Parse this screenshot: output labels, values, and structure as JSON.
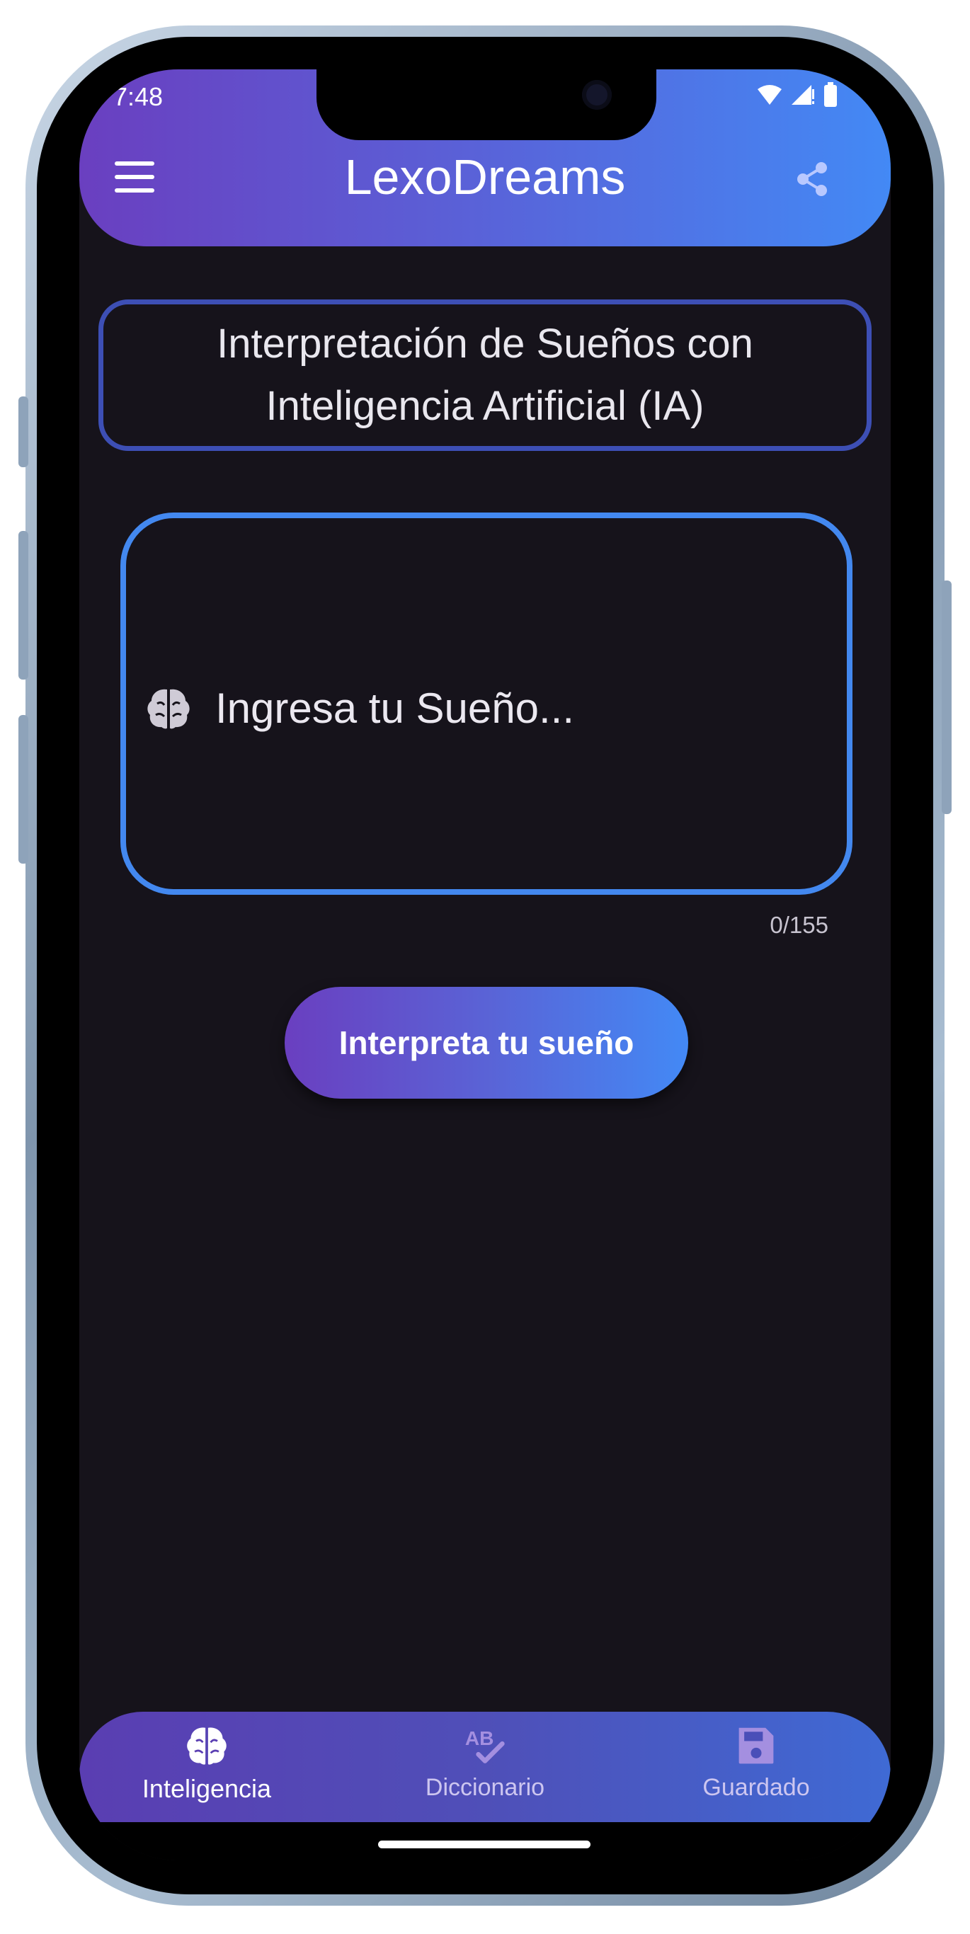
{
  "status_bar": {
    "time": "7:48"
  },
  "header": {
    "title": "LexoDreams",
    "menu_icon": "hamburger-menu-icon",
    "share_icon": "share-icon"
  },
  "title_box": {
    "text": "Interpretación de Sueños con Inteligencia Artificial (IA)"
  },
  "dream_input": {
    "placeholder": "Ingresa tu Sueño...",
    "counter": "0/155",
    "icon": "brain-icon"
  },
  "interpret_button": {
    "label": "Interpreta tu sueño"
  },
  "bottom_nav": {
    "items": [
      {
        "label": "Inteligencia",
        "icon": "brain-icon",
        "active": true
      },
      {
        "label": "Diccionario",
        "icon": "spellcheck-icon",
        "active": false
      },
      {
        "label": "Guardado",
        "icon": "save-icon",
        "active": false
      }
    ]
  },
  "colors": {
    "background": "#16131b",
    "gradient_start": "#6a3fc0",
    "gradient_end": "#4389f5",
    "title_border": "#3d4fb5",
    "input_border": "#4388ef",
    "inactive_nav": "#a48fe0"
  }
}
